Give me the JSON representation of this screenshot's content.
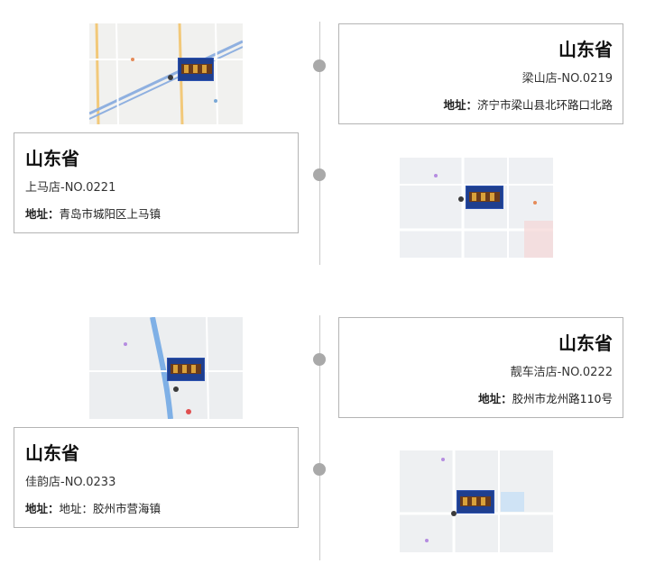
{
  "stores": [
    {
      "side": "right",
      "province": "山东省",
      "store_name": "梁山店-NO.0219",
      "address_label": "地址",
      "address": "济宁市梁山县北环路口北路"
    },
    {
      "side": "left",
      "province": "山东省",
      "store_name": "上马店-NO.0221",
      "address_label": "地址",
      "address": "青岛市城阳区上马镇"
    },
    {
      "side": "right",
      "province": "山东省",
      "store_name": "靓车洁店-NO.0222",
      "address_label": "地址",
      "address": "胶州市龙州路110号"
    },
    {
      "side": "left",
      "province": "山东省",
      "store_name": "佳韵店-NO.0233",
      "address_label": "地址",
      "address": "地址：胶州市营海镇"
    }
  ],
  "colors": {
    "accent_blue": "#1f3f8f",
    "dot_gray": "#a9a9a9",
    "line_gray": "#c9c9c9",
    "card_border": "#b4b4b4"
  }
}
